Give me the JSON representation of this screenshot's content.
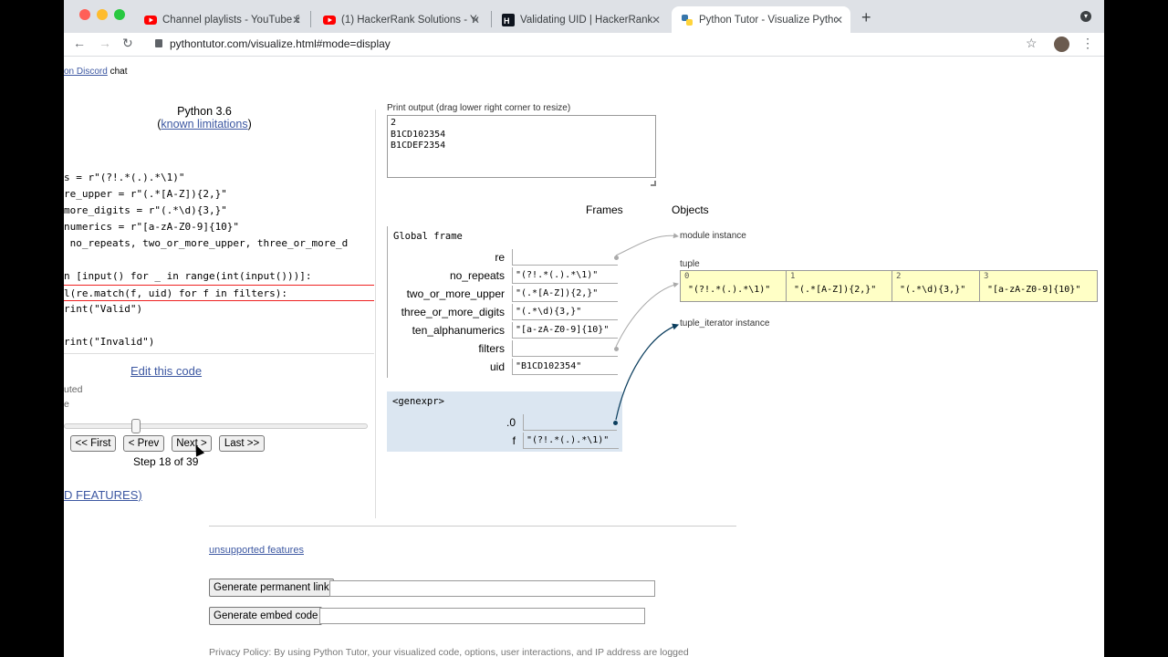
{
  "browser": {
    "tabs": [
      {
        "title": "Channel playlists - YouTube Stu",
        "icon": "youtube-icon"
      },
      {
        "title": "(1) HackerRank Solutions - You",
        "icon": "youtube-icon"
      },
      {
        "title": "Validating UID | HackerRank",
        "icon": "hackerrank-icon"
      },
      {
        "title": "Python Tutor - Visualize Python",
        "icon": "python-icon"
      }
    ],
    "url": "pythontutor.com/visualize.html#mode=display"
  },
  "page": {
    "top_chat_link": "on Discord",
    "top_chat_suffix": " chat",
    "language": "Python 3.6",
    "limitations_link": "known limitations",
    "code_lines": [
      "s = r\"(?!.*(.).*\\1)\"",
      "re_upper = r\"(.*[A-Z]){2,}\"",
      "more_digits = r\"(.*\\d){3,}\"",
      "numerics = r\"[a-zA-Z0-9]{10}\"",
      " no_repeats, two_or_more_upper, three_or_more_d",
      "",
      "n [input() for _ in range(int(input()))]:",
      "l(re.match(f, uid) for f in filters):",
      "rint(\"Valid\")",
      "",
      "rint(\"Invalid\")"
    ],
    "edit_link": "Edit this code",
    "legend_line1": "uted",
    "legend_line2": "e",
    "buttons": {
      "first": "<< First",
      "prev": "< Prev",
      "next": "Next >",
      "last": "Last >>"
    },
    "step_text": "Step 18 of 39",
    "step_progress": 0.46,
    "features_link": "D FEATURES)",
    "print_label": "Print output (drag lower right corner to resize)",
    "print_output": "2\nB1CD102354\nB1CDEF2354",
    "frames_header": "Frames",
    "objects_header": "Objects",
    "global_frame": {
      "title": "Global frame",
      "vars": [
        {
          "name": "re",
          "value": ""
        },
        {
          "name": "no_repeats",
          "value": "\"(?!.*(.).*\\1)\""
        },
        {
          "name": "two_or_more_upper",
          "value": "\"(.*[A-Z]){2,}\""
        },
        {
          "name": "three_or_more_digits",
          "value": "\"(.*\\d){3,}\""
        },
        {
          "name": "ten_alphanumerics",
          "value": "\"[a-zA-Z0-9]{10}\""
        },
        {
          "name": "filters",
          "value": ""
        },
        {
          "name": "uid",
          "value": "\"B1CD102354\""
        }
      ]
    },
    "genexpr_frame": {
      "title": "<genexpr>",
      "vars": [
        {
          "name": ".0",
          "value": ""
        },
        {
          "name": "f",
          "value": "\"(?!.*(.).*\\1)\""
        }
      ]
    },
    "objects": {
      "module_label": "module instance",
      "tuple_label": "tuple",
      "tuple_items": [
        {
          "index": "0",
          "value": "\"(?!.*(.).*\\1)\""
        },
        {
          "index": "1",
          "value": "\"(.*[A-Z]){2,}\""
        },
        {
          "index": "2",
          "value": "\"(.*\\d){3,}\""
        },
        {
          "index": "3",
          "value": "\"[a-zA-Z0-9]{10}\""
        }
      ],
      "iterator_label": "tuple_iterator instance"
    },
    "unsupported_link": "unsupported features",
    "permalink_button": "Generate permanent link",
    "embed_button": "Generate embed code",
    "privacy_text": "Privacy Policy: By using Python Tutor, your visualized code, options, user interactions, and IP address are logged"
  }
}
